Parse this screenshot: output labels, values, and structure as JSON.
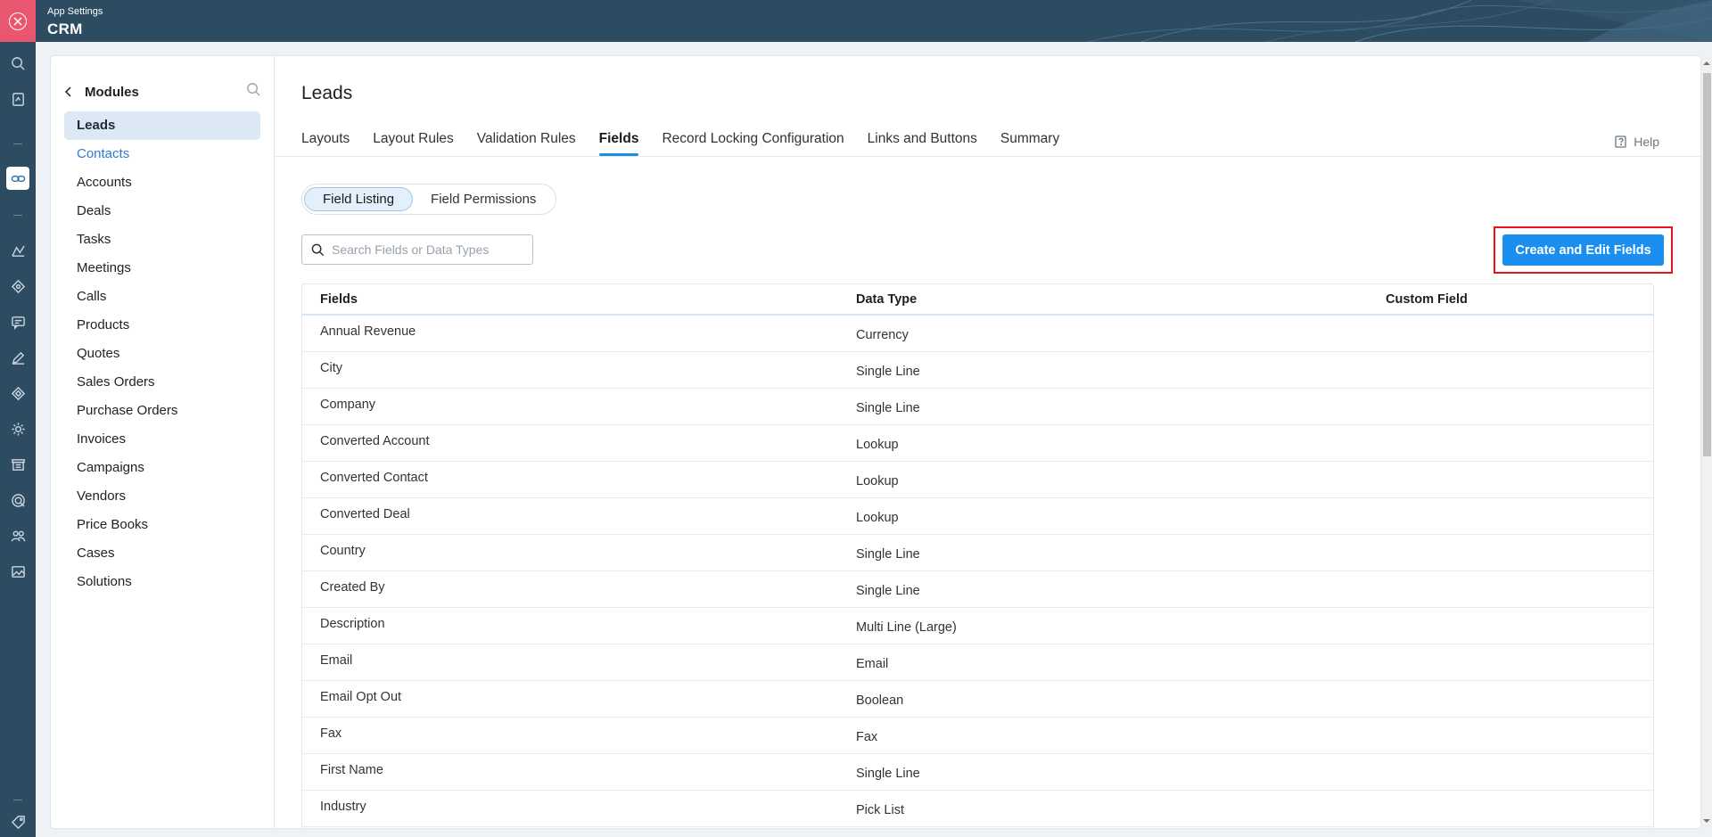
{
  "topbar": {
    "subtitle": "App Settings",
    "title": "CRM"
  },
  "rail": {
    "icons": [
      "close-icon",
      "search-icon",
      "notes-icon",
      "link-icon",
      "analytics-icon",
      "workflow-icon",
      "chat-icon",
      "pen-icon",
      "diamond-icon",
      "gear-icon",
      "archive-icon",
      "target-icon",
      "people-icon",
      "image-icon",
      "tag-icon"
    ]
  },
  "modules": {
    "header": "Modules",
    "items": [
      {
        "label": "Leads",
        "state": "active"
      },
      {
        "label": "Contacts",
        "state": "link"
      },
      {
        "label": "Accounts"
      },
      {
        "label": "Deals"
      },
      {
        "label": "Tasks"
      },
      {
        "label": "Meetings"
      },
      {
        "label": "Calls"
      },
      {
        "label": "Products"
      },
      {
        "label": "Quotes"
      },
      {
        "label": "Sales Orders"
      },
      {
        "label": "Purchase Orders"
      },
      {
        "label": "Invoices"
      },
      {
        "label": "Campaigns"
      },
      {
        "label": "Vendors"
      },
      {
        "label": "Price Books"
      },
      {
        "label": "Cases"
      },
      {
        "label": "Solutions"
      }
    ]
  },
  "main": {
    "title": "Leads",
    "tabs": [
      "Layouts",
      "Layout Rules",
      "Validation Rules",
      "Fields",
      "Record Locking Configuration",
      "Links and Buttons",
      "Summary"
    ],
    "active_tab": "Fields",
    "help_label": "Help",
    "segments": [
      "Field Listing",
      "Field Permissions"
    ],
    "active_segment": "Field Listing",
    "search_placeholder": "Search Fields or Data Types",
    "create_button": "Create and Edit Fields"
  },
  "table": {
    "columns": [
      "Fields",
      "Data Type",
      "Custom Field"
    ],
    "rows": [
      [
        "Annual Revenue",
        "Currency",
        ""
      ],
      [
        "City",
        "Single Line",
        ""
      ],
      [
        "Company",
        "Single Line",
        ""
      ],
      [
        "Converted Account",
        "Lookup",
        ""
      ],
      [
        "Converted Contact",
        "Lookup",
        ""
      ],
      [
        "Converted Deal",
        "Lookup",
        ""
      ],
      [
        "Country",
        "Single Line",
        ""
      ],
      [
        "Created By",
        "Single Line",
        ""
      ],
      [
        "Description",
        "Multi Line (Large)",
        ""
      ],
      [
        "Email",
        "Email",
        ""
      ],
      [
        "Email Opt Out",
        "Boolean",
        ""
      ],
      [
        "Fax",
        "Fax",
        ""
      ],
      [
        "First Name",
        "Single Line",
        ""
      ],
      [
        "Industry",
        "Pick List",
        ""
      ]
    ]
  },
  "colors": {
    "rail_bg": "#2d4b61",
    "close_bg": "#e9566f",
    "accent": "#1a8ff0",
    "highlight_border": "#e6141d"
  }
}
